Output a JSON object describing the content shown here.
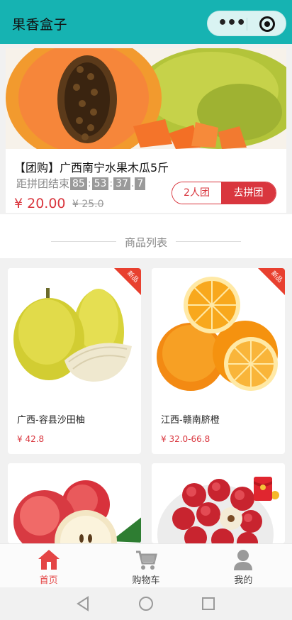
{
  "header": {
    "title": "果香盒子"
  },
  "group_buy": {
    "title": "【团购】广西南宁水果木瓜5斤",
    "countdown_label": "距拼团结束",
    "countdown": {
      "h": "85",
      "m": "53",
      "s": "37",
      "ms": "7"
    },
    "price": "¥ 20.00",
    "old_price": "¥ 25.0",
    "team_label": "2人团",
    "join_label": "去拼团"
  },
  "section": {
    "title": "商品列表"
  },
  "products": [
    {
      "name": "广西-容县沙田柚",
      "price": "¥ 42.8",
      "badge": "新品"
    },
    {
      "name": "江西-赣南脐橙",
      "price": "¥ 32.0-66.8",
      "badge": "新品"
    },
    {
      "name": "",
      "price": "",
      "badge": ""
    },
    {
      "name": "",
      "price": "",
      "badge": ""
    }
  ],
  "tabbar": {
    "items": [
      {
        "label": "首页",
        "icon": "home-icon",
        "active": true
      },
      {
        "label": "购物车",
        "icon": "cart-icon",
        "active": false
      },
      {
        "label": "我的",
        "icon": "user-icon",
        "active": false
      }
    ]
  },
  "colors": {
    "header": "#16b3b2",
    "accent": "#d9363e",
    "tab_active": "#e44545"
  }
}
